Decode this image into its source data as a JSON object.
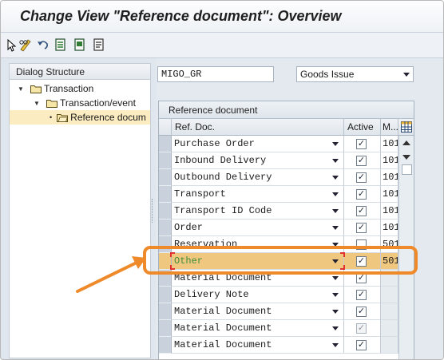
{
  "window": {
    "title": "Change View \"Reference document\": Overview"
  },
  "toolbar": {
    "icons": [
      "pencil-glasses-icon",
      "undo-arrow-icon",
      "document-list-icon",
      "copy-document-icon",
      "print-icon"
    ]
  },
  "left_pane": {
    "header": "Dialog Structure",
    "tree": [
      {
        "label": "Transaction",
        "level": 0,
        "expanded": true
      },
      {
        "label": "Transaction/event",
        "level": 1,
        "expanded": true
      },
      {
        "label": "Reference docum",
        "level": 2,
        "selected": true
      }
    ]
  },
  "filters": {
    "transaction_value": "MIGO_GR",
    "event_value": "Goods Issue"
  },
  "table": {
    "title": "Reference document",
    "columns": [
      "Ref. Doc.",
      "Active",
      "M..."
    ],
    "rows": [
      {
        "ref_doc": "Purchase Order",
        "active": true,
        "mvt": "101"
      },
      {
        "ref_doc": "Inbound Delivery",
        "active": true,
        "mvt": "101"
      },
      {
        "ref_doc": "Outbound Delivery",
        "active": true,
        "mvt": "101"
      },
      {
        "ref_doc": "Transport",
        "active": true,
        "mvt": "101"
      },
      {
        "ref_doc": "Transport ID Code",
        "active": true,
        "mvt": "101"
      },
      {
        "ref_doc": "Order",
        "active": true,
        "mvt": "101"
      },
      {
        "ref_doc": "Reservation",
        "active": false,
        "mvt": "501"
      },
      {
        "ref_doc": "Other",
        "active": true,
        "mvt": "501",
        "highlighted": true
      },
      {
        "ref_doc": "Material Document",
        "active": true,
        "mvt": ""
      },
      {
        "ref_doc": "Delivery Note",
        "active": true,
        "mvt": ""
      },
      {
        "ref_doc": "Material Document",
        "active": true,
        "mvt": ""
      },
      {
        "ref_doc": "Material Document",
        "active": true,
        "mvt": "",
        "disabled": true
      },
      {
        "ref_doc": "Material Document",
        "active": true,
        "mvt": ""
      }
    ]
  },
  "colors": {
    "highlight_row": "#f0c77f",
    "annotation": "#ee8a2a",
    "selected_tree": "#fbecc1"
  }
}
